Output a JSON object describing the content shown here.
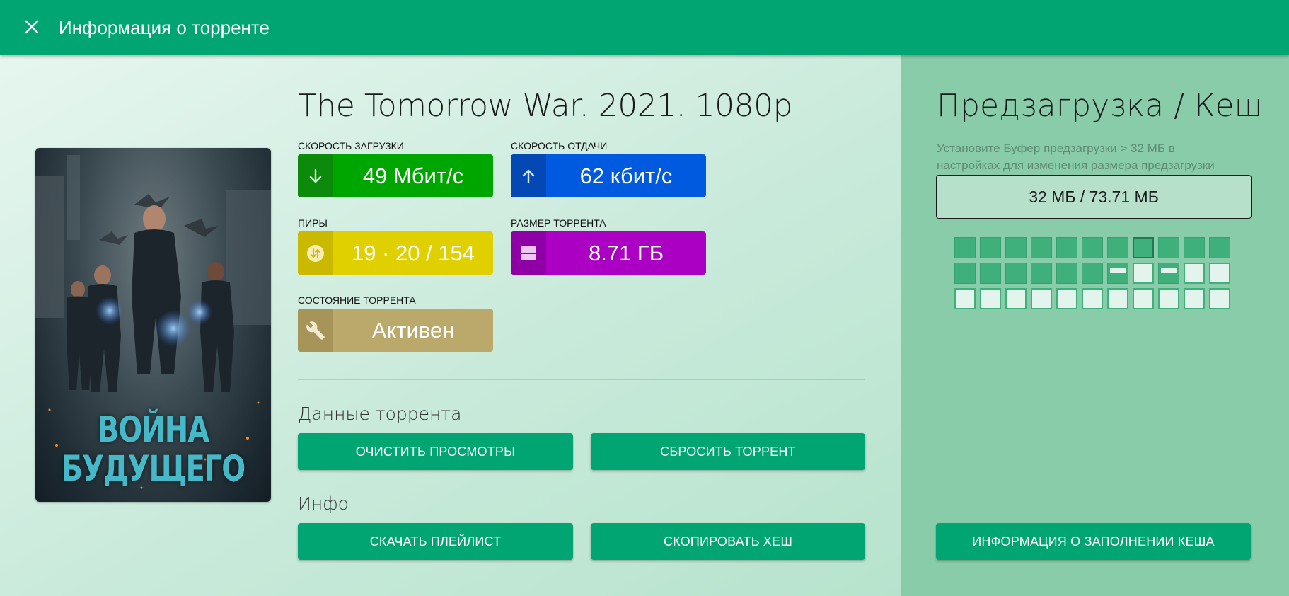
{
  "header": {
    "title": "Информация о торренте",
    "close_icon": "close-icon"
  },
  "torrent": {
    "title": "The Tomorrow War. 2021. 1080p",
    "poster": {
      "title_line1": "ВОЙНА",
      "title_line2": "БУДУЩЕГО"
    },
    "stats": {
      "download": {
        "label": "Скорость загрузки",
        "value": "49 Мбит/с",
        "icon": "arrow-down-icon",
        "color": "#00a600",
        "icon_bg": "#0b8a0b"
      },
      "upload": {
        "label": "Скорость отдачи",
        "value": "62 кбит/с",
        "icon": "arrow-up-icon",
        "color": "#005ae0",
        "icon_bg": "#0448b5"
      },
      "peers": {
        "label": "Пиры",
        "value": "19 · 20 / 154",
        "icon": "peers-icon",
        "color": "#e1d000",
        "icon_bg": "#cbb900"
      },
      "size": {
        "label": "Размер торрента",
        "value": "8.71 ГБ",
        "icon": "storage-icon",
        "color": "#ab00c4",
        "icon_bg": "#8e00a6"
      },
      "state": {
        "label": "Состояние торрента",
        "value": "Активен",
        "icon": "wrench-icon",
        "color": "#bba86b",
        "icon_bg": "#a69458"
      }
    }
  },
  "sections": {
    "data": {
      "title": "Данные торрента",
      "clear_views": "Очистить просмотры",
      "reset_torrent": "Сбросить торрент"
    },
    "info": {
      "title": "Инфо",
      "download_playlist": "Скачать плейлист",
      "copy_hash": "Скопировать хеш"
    }
  },
  "preload": {
    "title": "Предзагрузка / Кеш",
    "hint_line1": "Установите Буфер предзагрузки > 32 МБ в",
    "hint_line2": "настройках для изменения размера предзагрузки",
    "cache_value": "32 МБ / 73.71 МБ",
    "pieces": [
      "full",
      "full",
      "full",
      "full",
      "full",
      "full",
      "full",
      "active",
      "full",
      "full",
      "full",
      "full",
      "full",
      "full",
      "full",
      "full",
      "full",
      "partial",
      "empty",
      "partial",
      "empty",
      "empty",
      "empty",
      "empty",
      "empty",
      "empty",
      "empty",
      "empty",
      "empty",
      "empty",
      "empty",
      "empty",
      "empty"
    ],
    "cache_info_button": "Информация о заполнении кеша"
  }
}
